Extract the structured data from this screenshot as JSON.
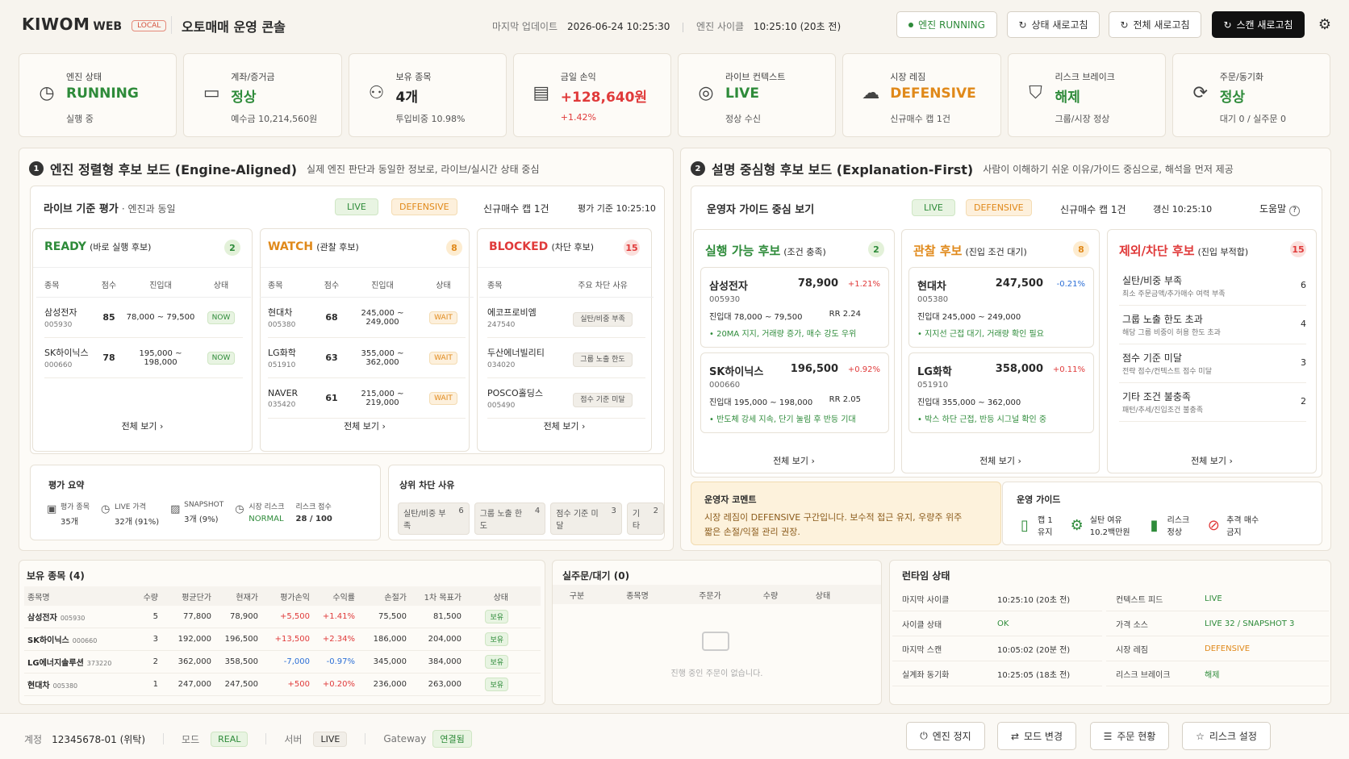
{
  "header": {
    "brand": "KIWOM",
    "brand_web": "WEB",
    "local_tag": "LOCAL",
    "title": "오토매매 운영 콘솔",
    "last_update_label": "마지막 업데이트",
    "last_update": "2026-06-24  10:25:30",
    "cycle_label": "엔진 사이클",
    "cycle": "10:25:10 (20초 전)",
    "engine_status": "엔진 RUNNING",
    "btn_status": "상태 새로고침",
    "btn_all": "전체 새로고침",
    "btn_scan": "스캔 새로고침"
  },
  "stats": [
    {
      "label": "엔진 상태",
      "value": "RUNNING",
      "sub": "실행 중",
      "color": "#2e8b3a",
      "icon": "clock-icon"
    },
    {
      "label": "계좌/증거금",
      "value": "정상",
      "sub": "예수금  10,214,560원",
      "color": "#2e8b3a",
      "icon": "wallet-icon"
    },
    {
      "label": "보유 종목",
      "value": "4개",
      "sub": "투입비중  10.98%",
      "color": "#222",
      "icon": "users-icon"
    },
    {
      "label": "금일 손익",
      "value": "+128,640원",
      "sub": "+1.42%",
      "color": "#e03a3a",
      "icon": "chart-icon"
    },
    {
      "label": "라이브 컨텍스트",
      "value": "LIVE",
      "sub": "정상 수신",
      "color": "#2e8b3a",
      "icon": "signal-icon"
    },
    {
      "label": "시장 레짐",
      "value": "DEFENSIVE",
      "sub": "신규매수 캡  1건",
      "color": "#e0891a",
      "icon": "cloud-icon"
    },
    {
      "label": "리스크 브레이크",
      "value": "해제",
      "sub": "그룹/시장 정상",
      "color": "#2e8b3a",
      "icon": "shield-icon"
    },
    {
      "label": "주문/동기화",
      "value": "정상",
      "sub": "대기 0  /  실주문 0",
      "color": "#2e8b3a",
      "icon": "sync-icon"
    }
  ],
  "left": {
    "num": "1",
    "title": "엔진 정렬형 후보 보드 (Engine-Aligned)",
    "desc": "실제 엔진 판단과 동일한 정보로, 라이브/실시간 상태 중심",
    "sub_title": "라이브 기준 평가",
    "sub_title2": "· 엔진과 동일",
    "tag_live": "LIVE",
    "tag_def": "DEFENSIVE",
    "cap": "신규매수 캡  1건",
    "basis": "평가 기준  10:25:10",
    "ready": {
      "title": "READY",
      "paren": "(바로 실행 후보)",
      "count": "2",
      "cols": [
        "종목",
        "점수",
        "진입대",
        "상태"
      ],
      "rows": [
        {
          "name": "삼성전자",
          "code": "005930",
          "score": "85",
          "range": "78,000 ~ 79,500",
          "state": "NOW"
        },
        {
          "name": "SK하이닉스",
          "code": "000660",
          "score": "78",
          "range": "195,000 ~ 198,000",
          "state": "NOW"
        }
      ],
      "more": "전체 보기  ›"
    },
    "watch": {
      "title": "WATCH",
      "paren": "(관찰 후보)",
      "count": "8",
      "cols": [
        "종목",
        "점수",
        "진입대",
        "상태"
      ],
      "rows": [
        {
          "name": "현대차",
          "code": "005380",
          "score": "68",
          "range": "245,000 ~ 249,000",
          "state": "WAIT"
        },
        {
          "name": "LG화학",
          "code": "051910",
          "score": "63",
          "range": "355,000 ~ 362,000",
          "state": "WAIT"
        },
        {
          "name": "NAVER",
          "code": "035420",
          "score": "61",
          "range": "215,000 ~ 219,000",
          "state": "WAIT"
        }
      ],
      "more": "전체 보기  ›"
    },
    "blocked": {
      "title": "BLOCKED",
      "paren": "(차단 후보)",
      "count": "15",
      "cols": [
        "종목",
        "주요 차단 사유"
      ],
      "rows": [
        {
          "name": "에코프로비엠",
          "code": "247540",
          "reason": "실탄/비중 부족"
        },
        {
          "name": "두산에너빌리티",
          "code": "034020",
          "reason": "그룹 노출 한도"
        },
        {
          "name": "POSCO홀딩스",
          "code": "005490",
          "reason": "점수 기준 미달"
        }
      ],
      "more": "전체 보기  ›"
    },
    "summary": {
      "title": "평가 요약",
      "items": [
        {
          "label": "평가 종목",
          "value": "35개",
          "icon": "doc-icon"
        },
        {
          "label": "LIVE 가격",
          "value": "32개 (91%)",
          "icon": "clock-icon"
        },
        {
          "label": "SNAPSHOT",
          "value": "3개 (9%)",
          "icon": "image-icon"
        },
        {
          "label": "시장 리스크",
          "value": "NORMAL",
          "icon": "clock-icon"
        },
        {
          "label": "리스크 점수",
          "value": "28 / 100",
          "icon": ""
        }
      ]
    },
    "top_block": {
      "title": "상위 차단 사유",
      "tags": [
        {
          "label": "실탄/비중 부족",
          "n": "6"
        },
        {
          "label": "그룹 노출 한도",
          "n": "4"
        },
        {
          "label": "점수 기준 미달",
          "n": "3"
        },
        {
          "label": "기타",
          "n": "2"
        }
      ]
    }
  },
  "right": {
    "num": "2",
    "title": "설명 중심형 후보 보드 (Explanation-First)",
    "desc": "사람이 이해하기 쉬운 이유/가이드 중심으로, 해석을 먼저 제공",
    "sub_title": "운영자 가이드 중심 보기",
    "tag_live": "LIVE",
    "tag_def": "DEFENSIVE",
    "cap": "신규매수 캡  1건",
    "refresh": "갱신  10:25:10",
    "help": "도움말",
    "exec": {
      "title": "실행 가능 후보",
      "paren": "(조건 충족)",
      "count": "2",
      "items": [
        {
          "name": "삼성전자",
          "price": "78,900",
          "chg": "+1.21%",
          "code": "005930",
          "range": "진입대   78,000 ~ 79,500",
          "rr": "RR 2.24",
          "note": "• 20MA 지지, 거래량 증가, 매수 강도 우위"
        },
        {
          "name": "SK하이닉스",
          "price": "196,500",
          "chg": "+0.92%",
          "code": "000660",
          "range": "진입대   195,000 ~ 198,000",
          "rr": "RR 2.05",
          "note": "• 반도체 강세 지속, 단기 눌림 후 반등 기대"
        }
      ],
      "more": "전체 보기  ›"
    },
    "watch": {
      "title": "관찰 후보",
      "paren": "(진입 조건 대기)",
      "count": "8",
      "items": [
        {
          "name": "현대차",
          "price": "247,500",
          "chg": "-0.21%",
          "code": "005380",
          "range": "진입대   245,000 ~ 249,000",
          "note": "• 지지선 근접 대기, 거래량 확인 필요"
        },
        {
          "name": "LG화학",
          "price": "358,000",
          "chg": "+0.11%",
          "code": "051910",
          "range": "진입대   355,000 ~ 362,000",
          "note": "• 박스 하단 근접, 반등 시그널 확인 중"
        }
      ],
      "more": "전체 보기  ›"
    },
    "block": {
      "title": "제외/차단 후보",
      "paren": "(진입 부적합)",
      "count": "15",
      "items": [
        {
          "title": "실탄/비중 부족",
          "desc": "최소 주문금액/추가매수 여력 부족",
          "n": "6"
        },
        {
          "title": "그룹 노출 한도 초과",
          "desc": "해당 그룹 비중이 허용 한도 초과",
          "n": "4"
        },
        {
          "title": "점수 기준 미달",
          "desc": "전략 점수/컨텍스트 점수 미달",
          "n": "3"
        },
        {
          "title": "기타 조건 불충족",
          "desc": "패턴/추세/진입조건 불충족",
          "n": "2"
        }
      ],
      "more": "전체 보기  ›"
    },
    "comment": {
      "title": "운영자 코멘트",
      "text1": "시장 레짐이 DEFENSIVE 구간입니다. 보수적 접근 유지, 우량주 위주",
      "text2": "짧은 손절/익절 관리 권장."
    },
    "guide": {
      "title": "운영 가이드",
      "items": [
        {
          "l1": "캡 1",
          "l2": "유지",
          "icon": "battery-icon"
        },
        {
          "l1": "실탄 여유",
          "l2": "10.2백만원",
          "icon": "gear-icon"
        },
        {
          "l1": "리스크",
          "l2": "정상",
          "icon": "bars-icon"
        },
        {
          "l1": "추격 매수",
          "l2": "금지",
          "icon": "ban-icon"
        }
      ]
    }
  },
  "holdings": {
    "title": "보유 종목 (4)",
    "cols": [
      "종목명",
      "수량",
      "평균단가",
      "현재가",
      "평가손익",
      "수익률",
      "손절가",
      "1차 목표가",
      "상태"
    ],
    "rows": [
      {
        "name": "삼성전자",
        "code": "005930",
        "qty": "5",
        "avg": "77,800",
        "cur": "78,900",
        "pl": "+5,500",
        "rate": "+1.41%",
        "stop": "75,500",
        "target": "81,500",
        "state": "보유",
        "up": true
      },
      {
        "name": "SK하이닉스",
        "code": "000660",
        "qty": "3",
        "avg": "192,000",
        "cur": "196,500",
        "pl": "+13,500",
        "rate": "+2.34%",
        "stop": "186,000",
        "target": "204,000",
        "state": "보유",
        "up": true
      },
      {
        "name": "LG에너지솔루션",
        "code": "373220",
        "qty": "2",
        "avg": "362,000",
        "cur": "358,500",
        "pl": "-7,000",
        "rate": "-0.97%",
        "stop": "345,000",
        "target": "384,000",
        "state": "보유",
        "up": false
      },
      {
        "name": "현대차",
        "code": "005380",
        "qty": "1",
        "avg": "247,000",
        "cur": "247,500",
        "pl": "+500",
        "rate": "+0.20%",
        "stop": "236,000",
        "target": "263,000",
        "state": "보유",
        "up": true
      }
    ]
  },
  "orders": {
    "title": "실주문/대기 (0)",
    "cols": [
      "구분",
      "종목명",
      "주문가",
      "수량",
      "상태"
    ],
    "empty": "진행 중인 주문이 없습니다."
  },
  "runtime": {
    "title": "런타임 상태",
    "left": [
      {
        "k": "마지막 사이클",
        "v": "10:25:10 (20초 전)",
        "c": ""
      },
      {
        "k": "사이클 상태",
        "v": "OK",
        "c": "green"
      },
      {
        "k": "마지막 스캔",
        "v": "10:05:02 (20분 전)",
        "c": ""
      },
      {
        "k": "실계좌 동기화",
        "v": "10:25:05 (18초 전)",
        "c": ""
      }
    ],
    "right": [
      {
        "k": "컨텍스트 피드",
        "v": "LIVE",
        "c": "green"
      },
      {
        "k": "가격 소스",
        "v": "LIVE  32 / SNAPSHOT 3",
        "c": "green"
      },
      {
        "k": "시장 레짐",
        "v": "DEFENSIVE",
        "c": "orange"
      },
      {
        "k": "리스크 브레이크",
        "v": "해제",
        "c": "green"
      }
    ]
  },
  "footer": {
    "account_label": "계정",
    "account": "12345678-01 (위탁)",
    "mode_label": "모드",
    "mode": "REAL",
    "server_label": "서버",
    "server": "LIVE",
    "gw_label": "Gateway",
    "gw": "연결됨",
    "btn_stop": "엔진 정지",
    "btn_mode": "모드 변경",
    "btn_orders": "주문 현황",
    "btn_risk": "리스크 설정"
  }
}
